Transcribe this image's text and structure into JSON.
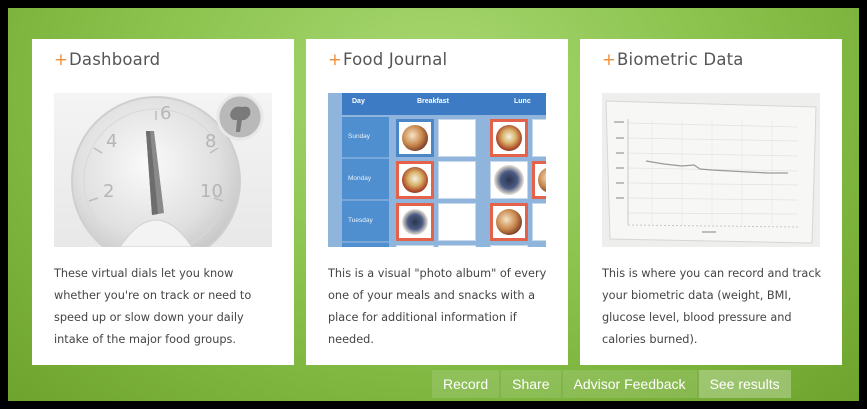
{
  "cards": [
    {
      "title": "Dashboard",
      "plus": "+",
      "text": "These virtual dials let you know whether you're on track or need to speed up or slow down your daily intake of the major food groups.",
      "dial_labels": [
        "2",
        "4",
        "6",
        "8",
        "10"
      ]
    },
    {
      "title": "Food Journal",
      "plus": "+",
      "text": "This is a visual \"photo album\" of every one of your meals and snacks with a place for additional information if needed.",
      "headers": [
        "Day",
        "Breakfast",
        "Lunc"
      ],
      "days": [
        "Sunday",
        "Monday",
        "Tuesday"
      ]
    },
    {
      "title": "Biometric Data",
      "plus": "+",
      "text": "This is where you can record and track your biometric data (weight, BMI, glucose level, blood pressure and calories burned)."
    }
  ],
  "nav": {
    "record": "Record",
    "share": "Share",
    "advisor": "Advisor Feedback",
    "results": "See results"
  }
}
